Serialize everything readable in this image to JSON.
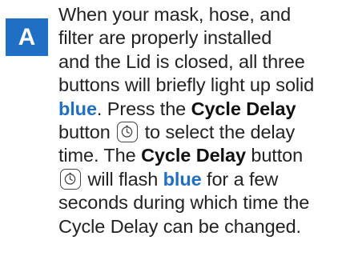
{
  "step": {
    "letter": "A"
  },
  "instructions": {
    "line1": "When your mask, hose, and",
    "line2": "filter are properly installed",
    "line3": "and the Lid is closed, all three",
    "line4": "buttons will briefly light up solid",
    "line5_kw_blue": "blue",
    "line5_text": ". Press the ",
    "line5_kw_button": "Cycle Delay",
    "line6_pre": "button",
    "line6_post": "to select the delay",
    "line7_text": "time. The ",
    "line7_kw_button": "Cycle Delay",
    "line7_post": " button",
    "line8_pre": "will flash ",
    "line8_kw_blue": "blue",
    "line8_post": " for a few",
    "line9": "seconds during which time the",
    "line10": "Cycle Delay can be changed."
  },
  "icons": {
    "cycle_delay_icon": "timer-clock-icon"
  },
  "colors": {
    "accent_blue": "#1f6fc4",
    "text": "#222222"
  }
}
